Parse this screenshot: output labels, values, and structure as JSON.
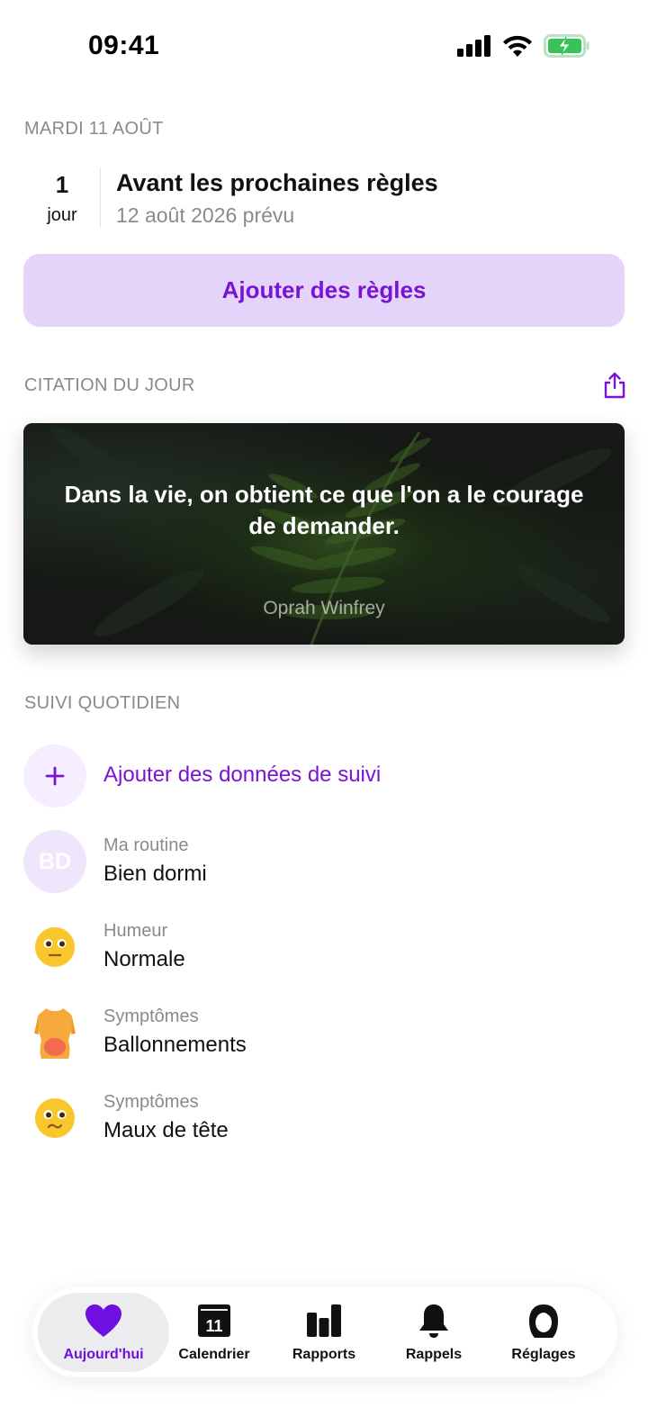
{
  "status": {
    "time": "09:41"
  },
  "header": {
    "date": "MARDI 11 AOÛT"
  },
  "countdown": {
    "number": "1",
    "unit": "jour",
    "title": "Avant les prochaines règles",
    "subtitle": "12 août 2026 prévu"
  },
  "actions": {
    "add_period": "Ajouter des règles"
  },
  "quote": {
    "section_label": "CITATION DU JOUR",
    "text": "Dans la vie, on obtient ce que l'on a le courage de demander.",
    "author": "Oprah Winfrey"
  },
  "tracking": {
    "section_label": "SUIVI QUOTIDIEN",
    "add_label": "Ajouter des données de suivi",
    "items": [
      {
        "initials": "BD",
        "category": "Ma routine",
        "value": "Bien dormi",
        "icon": "initials-avatar"
      },
      {
        "category": "Humeur",
        "value": "Normale",
        "icon": "neutral-face-icon"
      },
      {
        "category": "Symptômes",
        "value": "Ballonnements",
        "icon": "body-bloating-icon"
      },
      {
        "category": "Symptômes",
        "value": "Maux de tête",
        "icon": "headache-face-icon"
      }
    ]
  },
  "tabs": [
    {
      "label": "Aujourd'hui",
      "icon": "heart-icon",
      "active": true
    },
    {
      "label": "Calendrier",
      "icon": "calendar-icon",
      "day": "11"
    },
    {
      "label": "Rapports",
      "icon": "bar-chart-icon"
    },
    {
      "label": "Rappels",
      "icon": "bell-icon"
    },
    {
      "label": "Réglages",
      "icon": "profile-icon"
    }
  ],
  "colors": {
    "accent": "#7a14d4",
    "accent_light": "#e5d4fa",
    "muted_text": "#8a8a8e",
    "battery_green": "#3ac25a"
  }
}
